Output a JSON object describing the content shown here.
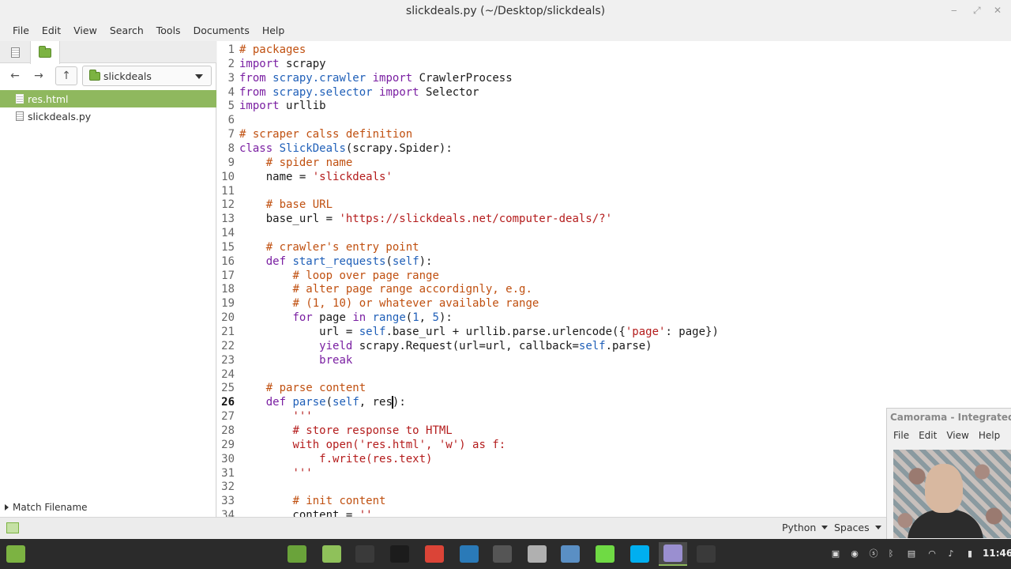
{
  "window": {
    "title": "slickdeals.py (~/Desktop/slickdeals)",
    "minimize": "‒",
    "maximize": "⤢",
    "close": "✕"
  },
  "menubar": [
    "File",
    "Edit",
    "View",
    "Search",
    "Tools",
    "Documents",
    "Help"
  ],
  "sidepane": {
    "folder": "slickdeals",
    "files": [
      {
        "name": "res.html",
        "selected": true
      },
      {
        "name": "slickdeals.py",
        "selected": false
      }
    ],
    "match_filename": "Match Filename"
  },
  "editor": {
    "current_line": 26,
    "lines": [
      {
        "n": "1",
        "t": [
          [
            "cm",
            "# packages"
          ]
        ]
      },
      {
        "n": "2",
        "t": [
          [
            "kw",
            "import"
          ],
          [
            "",
            " scrapy"
          ]
        ]
      },
      {
        "n": "3",
        "t": [
          [
            "kw",
            "from"
          ],
          [
            "",
            " "
          ],
          [
            "nm",
            "scrapy.crawler"
          ],
          [
            "",
            " "
          ],
          [
            "kw",
            "import"
          ],
          [
            "",
            " CrawlerProcess"
          ]
        ]
      },
      {
        "n": "4",
        "t": [
          [
            "kw",
            "from"
          ],
          [
            "",
            " "
          ],
          [
            "nm",
            "scrapy.selector"
          ],
          [
            "",
            " "
          ],
          [
            "kw",
            "import"
          ],
          [
            "",
            " Selector"
          ]
        ]
      },
      {
        "n": "5",
        "t": [
          [
            "kw",
            "import"
          ],
          [
            "",
            " urllib"
          ]
        ]
      },
      {
        "n": "6",
        "t": []
      },
      {
        "n": "7",
        "t": [
          [
            "cm",
            "# scraper calss definition"
          ]
        ]
      },
      {
        "n": "8",
        "t": [
          [
            "kw",
            "class"
          ],
          [
            "",
            " "
          ],
          [
            "nm",
            "SlickDeals"
          ],
          [
            "",
            "(scrapy.Spider):"
          ]
        ]
      },
      {
        "n": "9",
        "t": [
          [
            "",
            "    "
          ],
          [
            "cm",
            "# spider name"
          ]
        ]
      },
      {
        "n": "10",
        "t": [
          [
            "",
            "    name = "
          ],
          [
            "st",
            "'slickdeals'"
          ]
        ]
      },
      {
        "n": "11",
        "t": []
      },
      {
        "n": "12",
        "t": [
          [
            "",
            "    "
          ],
          [
            "cm",
            "# base URL"
          ]
        ]
      },
      {
        "n": "13",
        "t": [
          [
            "",
            "    base_url = "
          ],
          [
            "st",
            "'https://slickdeals.net/computer-deals/?'"
          ]
        ]
      },
      {
        "n": "14",
        "t": []
      },
      {
        "n": "15",
        "t": [
          [
            "",
            "    "
          ],
          [
            "cm",
            "# crawler's entry point"
          ]
        ]
      },
      {
        "n": "16",
        "t": [
          [
            "",
            "    "
          ],
          [
            "kw",
            "def"
          ],
          [
            "",
            " "
          ],
          [
            "nm",
            "start_requests"
          ],
          [
            "",
            "("
          ],
          [
            "bi",
            "self"
          ],
          [
            "",
            "):"
          ]
        ]
      },
      {
        "n": "17",
        "t": [
          [
            "",
            "        "
          ],
          [
            "cm",
            "# loop over page range"
          ]
        ]
      },
      {
        "n": "18",
        "t": [
          [
            "",
            "        "
          ],
          [
            "cm",
            "# alter page range accordignly, e.g."
          ]
        ]
      },
      {
        "n": "19",
        "t": [
          [
            "",
            "        "
          ],
          [
            "cm",
            "# (1, 10) or whatever available range"
          ]
        ]
      },
      {
        "n": "20",
        "t": [
          [
            "",
            "        "
          ],
          [
            "kw",
            "for"
          ],
          [
            "",
            " page "
          ],
          [
            "kw",
            "in"
          ],
          [
            "",
            " "
          ],
          [
            "bi",
            "range"
          ],
          [
            "",
            "("
          ],
          [
            "bi",
            "1"
          ],
          [
            "",
            ", "
          ],
          [
            "bi",
            "5"
          ],
          [
            "",
            "):"
          ]
        ]
      },
      {
        "n": "21",
        "t": [
          [
            "",
            "            url = "
          ],
          [
            "bi",
            "self"
          ],
          [
            "",
            ".base_url + urllib.parse.urlencode({"
          ],
          [
            "st",
            "'page'"
          ],
          [
            "",
            ": page})"
          ]
        ]
      },
      {
        "n": "22",
        "t": [
          [
            "",
            "            "
          ],
          [
            "kw",
            "yield"
          ],
          [
            "",
            " scrapy.Request(url=url, callback="
          ],
          [
            "bi",
            "self"
          ],
          [
            "",
            ".parse)"
          ]
        ]
      },
      {
        "n": "23",
        "t": [
          [
            "",
            "            "
          ],
          [
            "kw",
            "break"
          ]
        ]
      },
      {
        "n": "24",
        "t": []
      },
      {
        "n": "25",
        "t": [
          [
            "",
            "    "
          ],
          [
            "cm",
            "# parse content"
          ]
        ]
      },
      {
        "n": "26",
        "t": [
          [
            "",
            "    "
          ],
          [
            "kw",
            "def"
          ],
          [
            "",
            " "
          ],
          [
            "nm",
            "parse"
          ],
          [
            "",
            "("
          ],
          [
            "bi",
            "self"
          ],
          [
            "",
            ", res"
          ],
          [
            "cursor",
            ""
          ],
          [
            "",
            "):"
          ]
        ]
      },
      {
        "n": "27",
        "t": [
          [
            "",
            "        "
          ],
          [
            "st",
            "'''"
          ]
        ]
      },
      {
        "n": "28",
        "t": [
          [
            "",
            "        "
          ],
          [
            "st",
            "# store response to HTML"
          ]
        ]
      },
      {
        "n": "29",
        "t": [
          [
            "",
            "        "
          ],
          [
            "st",
            "with open('res.html', 'w') as f:"
          ]
        ]
      },
      {
        "n": "30",
        "t": [
          [
            "",
            "            "
          ],
          [
            "st",
            "f.write(res.text)"
          ]
        ]
      },
      {
        "n": "31",
        "t": [
          [
            "",
            "        "
          ],
          [
            "st",
            "'''"
          ]
        ]
      },
      {
        "n": "32",
        "t": []
      },
      {
        "n": "33",
        "t": [
          [
            "",
            "        "
          ],
          [
            "cm",
            "# init content"
          ]
        ]
      },
      {
        "n": "34",
        "t": [
          [
            "",
            "        content = "
          ],
          [
            "st",
            "''"
          ]
        ]
      }
    ]
  },
  "statusbar": {
    "language": "Python",
    "indent": "Spaces"
  },
  "camorama": {
    "title": "Camorama - Integrated",
    "menu": [
      "File",
      "Edit",
      "View",
      "Help"
    ]
  },
  "taskbar": {
    "clock": "11:46",
    "apps": [
      {
        "name": "mint-menu",
        "color": "#7cb342"
      },
      {
        "name": "show-desktop",
        "color": "#6aa33a"
      },
      {
        "name": "files",
        "color": "#8fc15a"
      },
      {
        "name": "terminal",
        "color": "#3a3a3a"
      },
      {
        "name": "system-monitor",
        "color": "#1c1c1c"
      },
      {
        "name": "chrome",
        "color": "#db4437"
      },
      {
        "name": "mysql-workbench",
        "color": "#2a7ab8"
      },
      {
        "name": "calculator",
        "color": "#555555"
      },
      {
        "name": "user-manager",
        "color": "#b0b0b0"
      },
      {
        "name": "camera",
        "color": "#5a8fc4"
      },
      {
        "name": "upwork",
        "color": "#6fda44"
      },
      {
        "name": "skype",
        "color": "#00aff0"
      },
      {
        "name": "text-editor",
        "color": "#9a8fd0"
      },
      {
        "name": "terminal-2",
        "color": "#3a3a3a"
      }
    ]
  }
}
